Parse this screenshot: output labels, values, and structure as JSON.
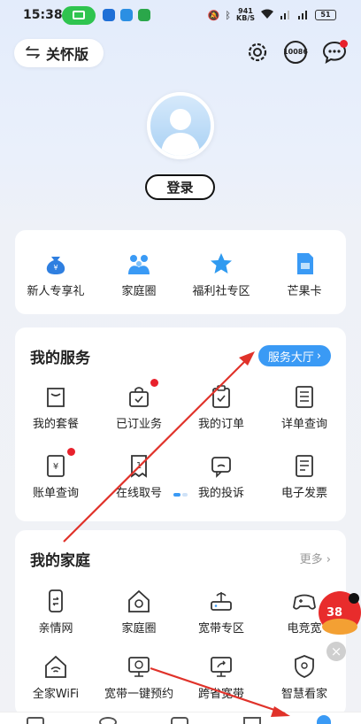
{
  "status_bar": {
    "time": "15:38",
    "network_speed_value": "941",
    "network_speed_unit": "KB/S",
    "battery": "51"
  },
  "header": {
    "care_mode_label": "关怀版",
    "hotline_label": "10086"
  },
  "profile": {
    "login_label": "登录"
  },
  "quick_links": [
    {
      "label": "新人专享礼",
      "icon": "money-bag-icon",
      "color": "#2f7fe0"
    },
    {
      "label": "家庭圈",
      "icon": "family-icon",
      "color": "#3a9af5"
    },
    {
      "label": "福利社专区",
      "icon": "star-icon",
      "color": "#2f9af0"
    },
    {
      "label": "芒果卡",
      "icon": "sim-card-icon",
      "color": "#3a9af5"
    }
  ],
  "services": {
    "title": "我的服务",
    "hall_label": "服务大厅",
    "items": [
      {
        "label": "我的套餐",
        "icon": "bag-icon"
      },
      {
        "label": "已订业务",
        "icon": "shopping-bag-icon"
      },
      {
        "label": "我的订单",
        "icon": "clipboard-icon"
      },
      {
        "label": "详单查询",
        "icon": "list-icon"
      },
      {
        "label": "账单查询",
        "icon": "bill-icon"
      },
      {
        "label": "在线取号",
        "icon": "ticket-icon"
      },
      {
        "label": "我的投诉",
        "icon": "complaint-icon"
      },
      {
        "label": "电子发票",
        "icon": "invoice-icon"
      }
    ]
  },
  "family": {
    "title": "我的家庭",
    "more_label": "更多",
    "items": [
      {
        "label": "亲情网",
        "icon": "phone-icon"
      },
      {
        "label": "家庭圈",
        "icon": "home-icon"
      },
      {
        "label": "宽带专区",
        "icon": "router-icon"
      },
      {
        "label": "电竞宽",
        "icon": "gamepad-icon"
      },
      {
        "label": "全家WiFi",
        "icon": "wifi-home-icon"
      },
      {
        "label": "宽带一键预约",
        "icon": "monitor-clock-icon"
      },
      {
        "label": "跨省宽带",
        "icon": "monitor-share-icon"
      },
      {
        "label": "智慧看家",
        "icon": "shield-home-icon"
      }
    ]
  },
  "colors": {
    "accent": "#3a9af5",
    "badge_red": "#e8212c",
    "annotation_arrow": "#e0322a"
  }
}
